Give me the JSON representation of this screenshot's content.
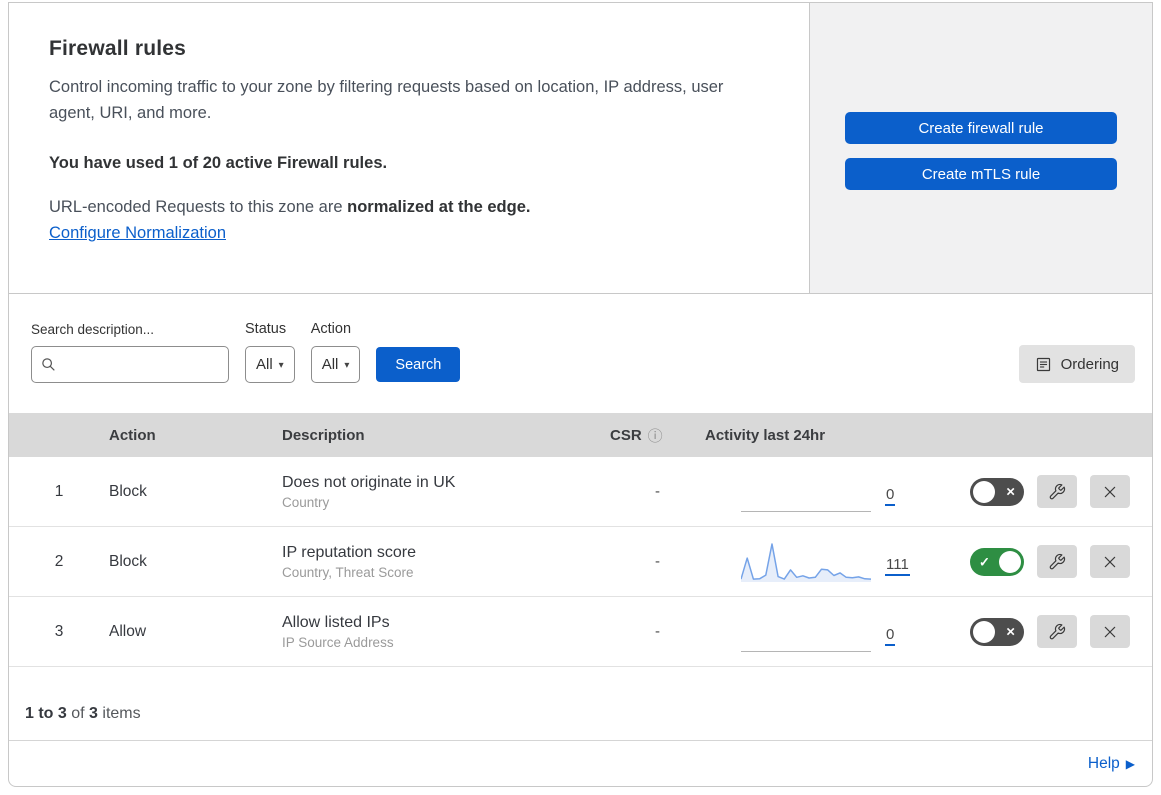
{
  "header": {
    "title": "Firewall rules",
    "description": "Control incoming traffic to your zone by filtering requests based on location, IP address, user agent, URI, and more.",
    "usage": "You have used 1 of 20 active Firewall rules.",
    "normalization_prefix": "URL-encoded Requests to this zone are",
    "normalization_bold": "normalized at the edge.",
    "normalization_link": "Configure Normalization"
  },
  "actions_panel": {
    "create_firewall_rule": "Create firewall rule",
    "create_mtls_rule": "Create mTLS rule"
  },
  "filters": {
    "search_label": "Search description...",
    "search_placeholder": "",
    "search_value": "",
    "status_label": "Status",
    "status_value": "All",
    "action_label": "Action",
    "action_value": "All",
    "search_button": "Search",
    "ordering_button": "Ordering"
  },
  "table": {
    "columns": {
      "action": "Action",
      "description": "Description",
      "csr": "CSR",
      "activity": "Activity last 24hr"
    },
    "rows": [
      {
        "priority": "1",
        "action": "Block",
        "description": "Does not originate in UK",
        "expression_fields": "Country",
        "csr": "-",
        "activity_count": "0",
        "enabled": false,
        "sparkline": []
      },
      {
        "priority": "2",
        "action": "Block",
        "description": "IP reputation score",
        "expression_fields": "Country, Threat Score",
        "csr": "-",
        "activity_count": "111",
        "enabled": true,
        "sparkline": [
          0.05,
          0.62,
          0.05,
          0.06,
          0.16,
          1.0,
          0.12,
          0.05,
          0.3,
          0.1,
          0.14,
          0.08,
          0.1,
          0.32,
          0.3,
          0.15,
          0.22,
          0.1,
          0.09,
          0.11,
          0.06,
          0.05
        ]
      },
      {
        "priority": "3",
        "action": "Allow",
        "description": "Allow listed IPs",
        "expression_fields": "IP Source Address",
        "csr": "-",
        "activity_count": "0",
        "enabled": false,
        "sparkline": []
      }
    ]
  },
  "footer": {
    "range": "1 to 3",
    "of": "of",
    "total": "3",
    "items_label": "items"
  },
  "help": {
    "label": "Help"
  },
  "icons": {
    "caret_down": "▾",
    "info": "ⓘ",
    "help_arrow": "▶",
    "check": "✓",
    "cross": "×"
  },
  "colors": {
    "accent_blue": "#0b5fcb",
    "toggle_on_green": "#2e8e43",
    "toggle_off_gray": "#4d4d4d",
    "sparkline_stroke": "#75a3e8",
    "sparkline_fill": "#dde7f8",
    "table_header_gray": "#d9d9d9",
    "panel_gray": "#f1f1f2"
  }
}
